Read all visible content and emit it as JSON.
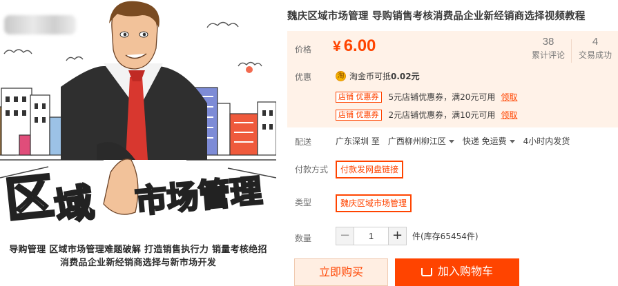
{
  "product": {
    "title": "魏庆区域市场管理 导购销售考核消费品企业新经销商选择视频教程"
  },
  "hero": {
    "title_main_left": "区",
    "title_main_highlight": "域",
    "title_main_right": "市场管理",
    "caption_line1": "导购管理  区域市场管理难题破解  打造销售执行力  销量考核绝招",
    "caption_line2": "消费品企业新经销商选择与新市场开发"
  },
  "price": {
    "label": "价格",
    "currency": "¥",
    "value": "6.00",
    "accent_color": "#ff4400"
  },
  "stats": {
    "reviews_count": "38",
    "reviews_label": "累计评论",
    "trades_count": "4",
    "trades_label": "交易成功"
  },
  "promotions": {
    "label": "优惠",
    "coin_icon_text": "淘",
    "coin_text": "淘金币可抵",
    "coin_amount": "0.02元",
    "coupons": [
      {
        "tag": "店铺  优惠券",
        "text": "5元店铺优惠券，满20元可用",
        "link": "领取"
      },
      {
        "tag": "店铺  优惠券",
        "text": "2元店铺优惠券，满10元可用",
        "link": "领取"
      }
    ]
  },
  "shipping": {
    "label": "配送",
    "origin": "广东深圳 至",
    "destination": "广西柳州柳江区",
    "method": "快递 免运费",
    "dispatch": "4小时内发货"
  },
  "payment": {
    "label": "付款方式",
    "option": "付款发网盘链接"
  },
  "type": {
    "label": "类型",
    "option": "魏庆区域市场管理"
  },
  "quantity": {
    "label": "数量",
    "minus": "−",
    "value": "1",
    "plus": "+",
    "stock": "件(库存65454件)"
  },
  "actions": {
    "buy_now": "立即购买",
    "add_to_cart": "加入购物车"
  }
}
